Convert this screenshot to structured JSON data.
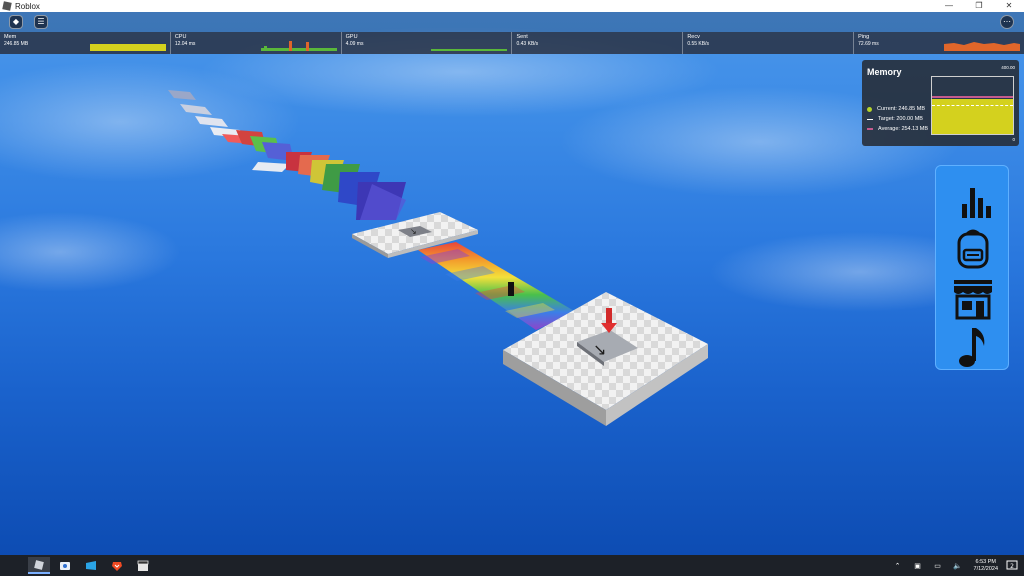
{
  "window": {
    "title": "Roblox",
    "controls": [
      "—",
      "❐",
      "✕"
    ]
  },
  "topbar": {
    "roblox_button": "roblox-menu-icon",
    "chat_button": "chat-icon",
    "more_button": "more-icon"
  },
  "stats": [
    {
      "name": "Mem",
      "value": "246.85 MB",
      "graph_color": "#d4d11e"
    },
    {
      "name": "CPU",
      "value": "12.04 ms",
      "graph_color": "#5ab83a"
    },
    {
      "name": "GPU",
      "value": "4.09 ms",
      "graph_color": "#5ab83a"
    },
    {
      "name": "Sent",
      "value": "0.43 KB/s",
      "graph_color": "#5ab83a"
    },
    {
      "name": "Recv",
      "value": "0.55 KB/s",
      "graph_color": "#5ab83a"
    },
    {
      "name": "Ping",
      "value": "72.69 ms",
      "graph_color": "#e0662a"
    }
  ],
  "memory_panel": {
    "title": "Memory",
    "axis_max": "400.00",
    "axis_min": "0",
    "current": {
      "label": "Current: 246.85 MB",
      "color": "#b6d42a"
    },
    "target": {
      "label": "Target: 200.00 MB",
      "color": "#ffffff"
    },
    "average": {
      "label": "Average: 254.13 MB",
      "color": "#c45a8e"
    },
    "current_fraction": 0.617,
    "target_fraction": 0.5,
    "average_fraction": 0.635
  },
  "side_menu": {
    "items": [
      "stats-icon",
      "backpack-icon",
      "shop-icon",
      "music-icon"
    ]
  },
  "taskbar": {
    "apps": [
      "roblox-app-icon",
      "screenshot-app-icon",
      "windows-app-icon",
      "brave-browser-icon",
      "clapper-app-icon"
    ],
    "time": "6:53 PM",
    "date": "7/12/2024",
    "notifications": "2"
  }
}
